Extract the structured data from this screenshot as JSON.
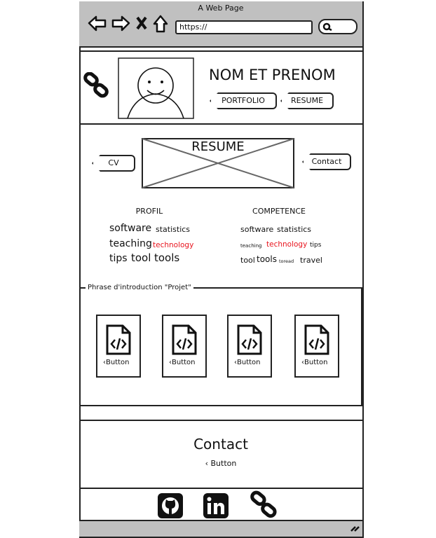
{
  "browser": {
    "title": "A Web Page",
    "url": "https://"
  },
  "header": {
    "name": "NOM ET PRENOM",
    "buttons": [
      "PORTFOLIO",
      "RESUME"
    ]
  },
  "resume": {
    "image_label": "RESUME",
    "left_button": "CV",
    "right_button": "Contact"
  },
  "profil": {
    "heading": "PROFIL",
    "words": [
      "software",
      "statistics",
      "teaching",
      "technology",
      "tips",
      "tool",
      "tools"
    ]
  },
  "competence": {
    "heading": "COMPETENCE",
    "words": [
      "software",
      "statistics",
      "teaching",
      "technology",
      "tips",
      "tool",
      "tools",
      "toread",
      "travel"
    ]
  },
  "projects": {
    "legend": "Phrase d'introduction \"Projet\"",
    "cards": [
      {
        "label": "Button"
      },
      {
        "label": "Button"
      },
      {
        "label": "Button"
      },
      {
        "label": "Button"
      }
    ]
  },
  "contact": {
    "title": "Contact",
    "button": "Button"
  },
  "footer": {
    "icons": [
      "github-icon",
      "linkedin-icon",
      "link-icon"
    ]
  },
  "colors": {
    "chrome": "#c0c0c0",
    "highlight": "#e8141e"
  }
}
